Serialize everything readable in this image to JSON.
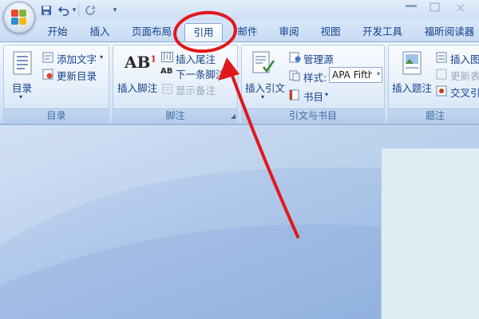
{
  "qat": {
    "dropdown_label": "▾"
  },
  "window": {
    "close_label": "×"
  },
  "tabs": [
    {
      "label": "开始"
    },
    {
      "label": "插入"
    },
    {
      "label": "页面布局"
    },
    {
      "label": "引用",
      "active": true
    },
    {
      "label": "邮件"
    },
    {
      "label": "审阅"
    },
    {
      "label": "视图"
    },
    {
      "label": "开发工具"
    },
    {
      "label": "福昕阅读器"
    }
  ],
  "groups": {
    "toc": {
      "label": "目录",
      "toc_button": "目录",
      "add_text": "添加文字",
      "update_toc": "更新目录"
    },
    "footnotes": {
      "label": "脚注",
      "insert_footnote": "插入脚注",
      "insert_endnote": "插入尾注",
      "next_footnote": "下一条脚注",
      "show_notes": "显示备注",
      "footnote_icon_text": "AB",
      "footnote_icon_sup": "1",
      "endnote_icon_text": "[i]",
      "next_icon_text": "AB"
    },
    "citations": {
      "label": "引文与书目",
      "insert_citation": "插入引文",
      "manage_sources": "管理源",
      "style_label": "样式:",
      "style_value": "APA Fifth",
      "bibliography": "书目"
    },
    "captions": {
      "label": "题注",
      "insert_caption": "插入题注",
      "insert_table": "插入图",
      "update_table": "更新表",
      "cross_reference": "交叉引"
    }
  },
  "colors": {
    "accent_red": "#e0181c",
    "ribbon_text": "#15428b",
    "office_logo": [
      "#e8492c",
      "#7fb53c",
      "#2a8fd8",
      "#f7b718"
    ]
  },
  "icons": {
    "save": "save-icon",
    "undo": "undo-icon",
    "redo": "redo-icon",
    "office": "office-logo-icon"
  }
}
